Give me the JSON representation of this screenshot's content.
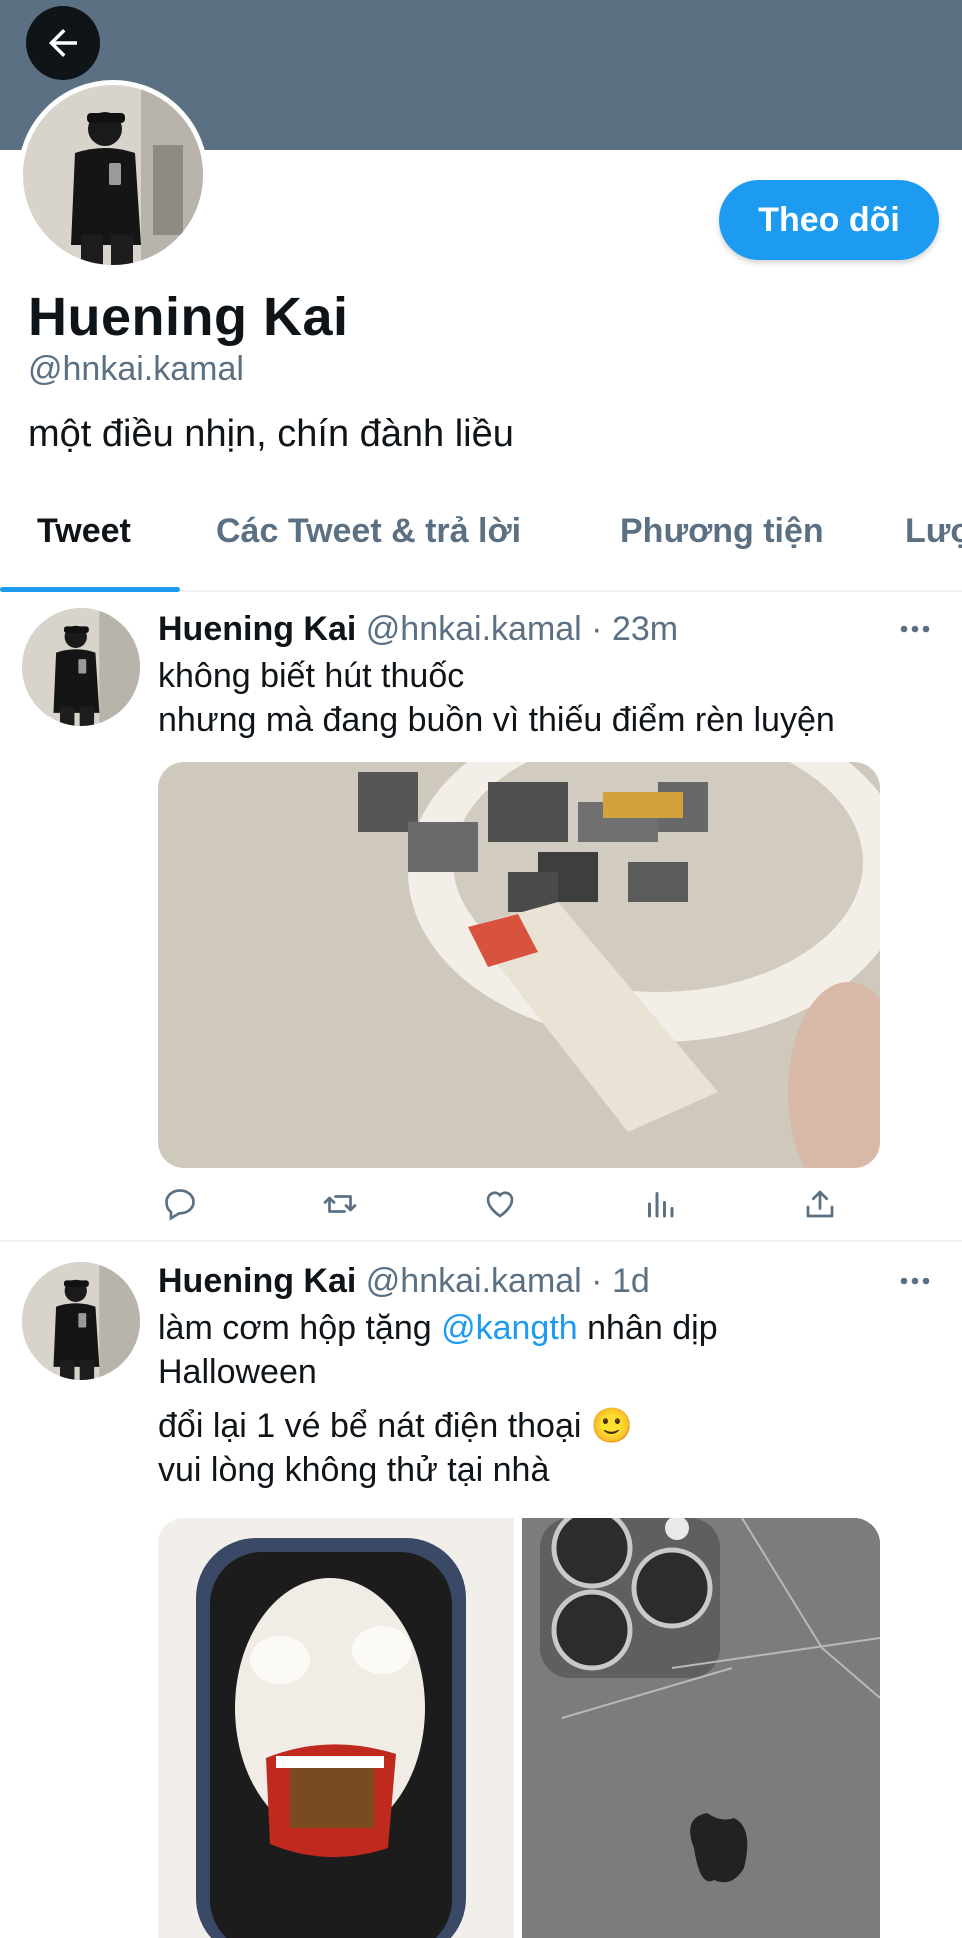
{
  "profile": {
    "name": "Huening Kai",
    "handle": "@hnkai.kamal",
    "bio": "một điều nhịn, chín đành liều",
    "follow_label": "Theo dõi"
  },
  "tabs": [
    {
      "label": "Tweet"
    },
    {
      "label": "Các Tweet & trả lời"
    },
    {
      "label": "Phương tiện"
    },
    {
      "label": "Lượ"
    }
  ],
  "tweets": [
    {
      "name": "Huening Kai",
      "handle_time": "@hnkai.kamal · 23m",
      "line1": "không biết hút thuốc",
      "line2": "nhưng mà đang buồn vì thiếu điểm rèn luyện"
    },
    {
      "name": "Huening Kai",
      "handle_time": "@hnkai.kamal · 1d",
      "line1_pre": "làm cơm hộp tặng ",
      "mention": "@kangth",
      "line1_post": " nhân dịp",
      "line2": "Halloween",
      "line3": "đổi lại 1 vé bể nát điện thoại 🙂",
      "line4": "vui lòng không thử tại nhà"
    }
  ],
  "icons": {
    "back": "arrow-left-icon",
    "more": "more-dots-icon",
    "reply": "reply-icon",
    "retweet": "retweet-icon",
    "like": "heart-icon",
    "views": "views-chart-icon",
    "share": "share-icon"
  },
  "colors": {
    "banner": "#5b7083",
    "accent": "#1d9bf0",
    "text": "#0f1419",
    "muted": "#5b7083"
  }
}
